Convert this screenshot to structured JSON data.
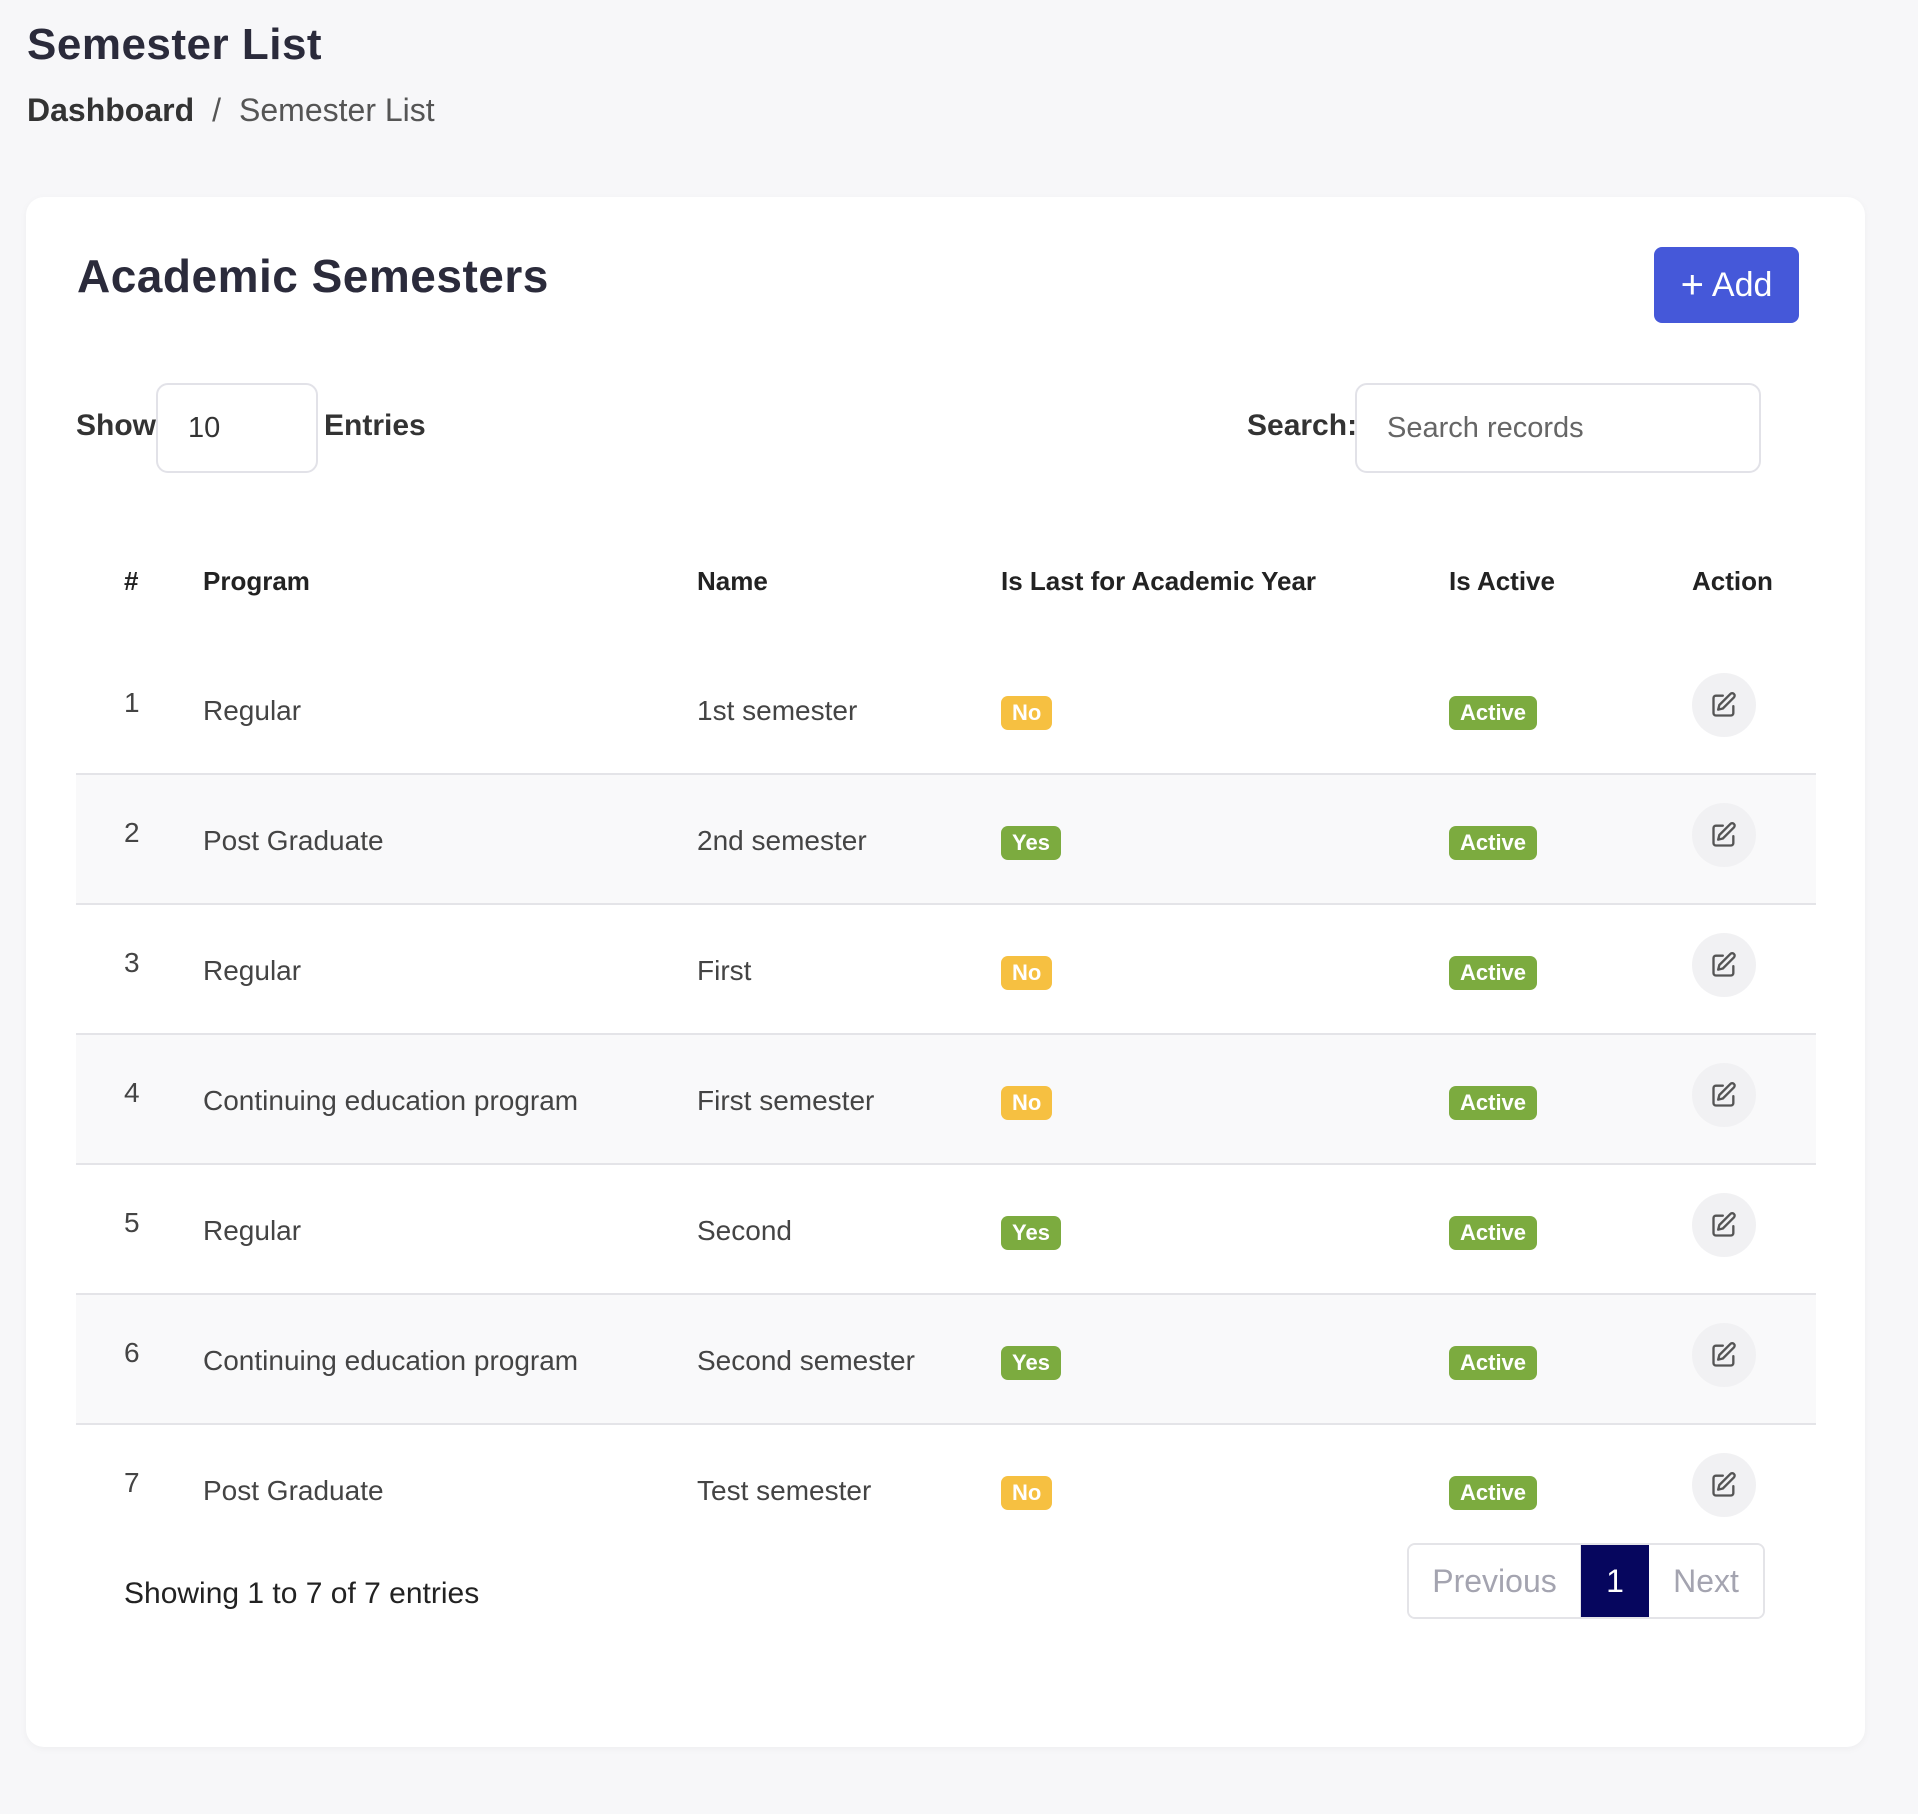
{
  "page": {
    "title": "Semester List",
    "breadcrumb": {
      "home": "Dashboard",
      "separator": "/",
      "current": "Semester List"
    }
  },
  "card": {
    "title": "Academic Semesters",
    "add_label": "Add",
    "add_icon": "+"
  },
  "controls": {
    "show_label": "Show",
    "entries_value": "10",
    "entries_label": "Entries",
    "search_label": "Search:",
    "search_placeholder": "Search records",
    "search_value": ""
  },
  "table": {
    "headers": [
      "#",
      "Program",
      "Name",
      "Is Last for Academic Year",
      "Is Active",
      "Action"
    ],
    "rows": [
      {
        "num": "1",
        "program": "Regular",
        "name": "1st semester",
        "is_last": "No",
        "is_active": "Active"
      },
      {
        "num": "2",
        "program": "Post Graduate",
        "name": "2nd semester",
        "is_last": "Yes",
        "is_active": "Active"
      },
      {
        "num": "3",
        "program": "Regular",
        "name": "First",
        "is_last": "No",
        "is_active": "Active"
      },
      {
        "num": "4",
        "program": "Continuing education program",
        "name": "First semester",
        "is_last": "No",
        "is_active": "Active"
      },
      {
        "num": "5",
        "program": "Regular",
        "name": "Second",
        "is_last": "Yes",
        "is_active": "Active"
      },
      {
        "num": "6",
        "program": "Continuing education program",
        "name": "Second semester",
        "is_last": "Yes",
        "is_active": "Active"
      },
      {
        "num": "7",
        "program": "Post Graduate",
        "name": "Test semester",
        "is_last": "No",
        "is_active": "Active"
      }
    ]
  },
  "footer": {
    "showing_text": "Showing 1 to 7 of 7 entries",
    "pagination": {
      "previous": "Previous",
      "current_page": "1",
      "next": "Next"
    }
  },
  "colors": {
    "primary": "#4558d9",
    "badge_no": "#f6c041",
    "badge_yes": "#7cab3f",
    "badge_active": "#7cab3f",
    "page_current": "#06065e"
  },
  "icons": {
    "add": "plus-icon",
    "edit": "edit-icon"
  }
}
